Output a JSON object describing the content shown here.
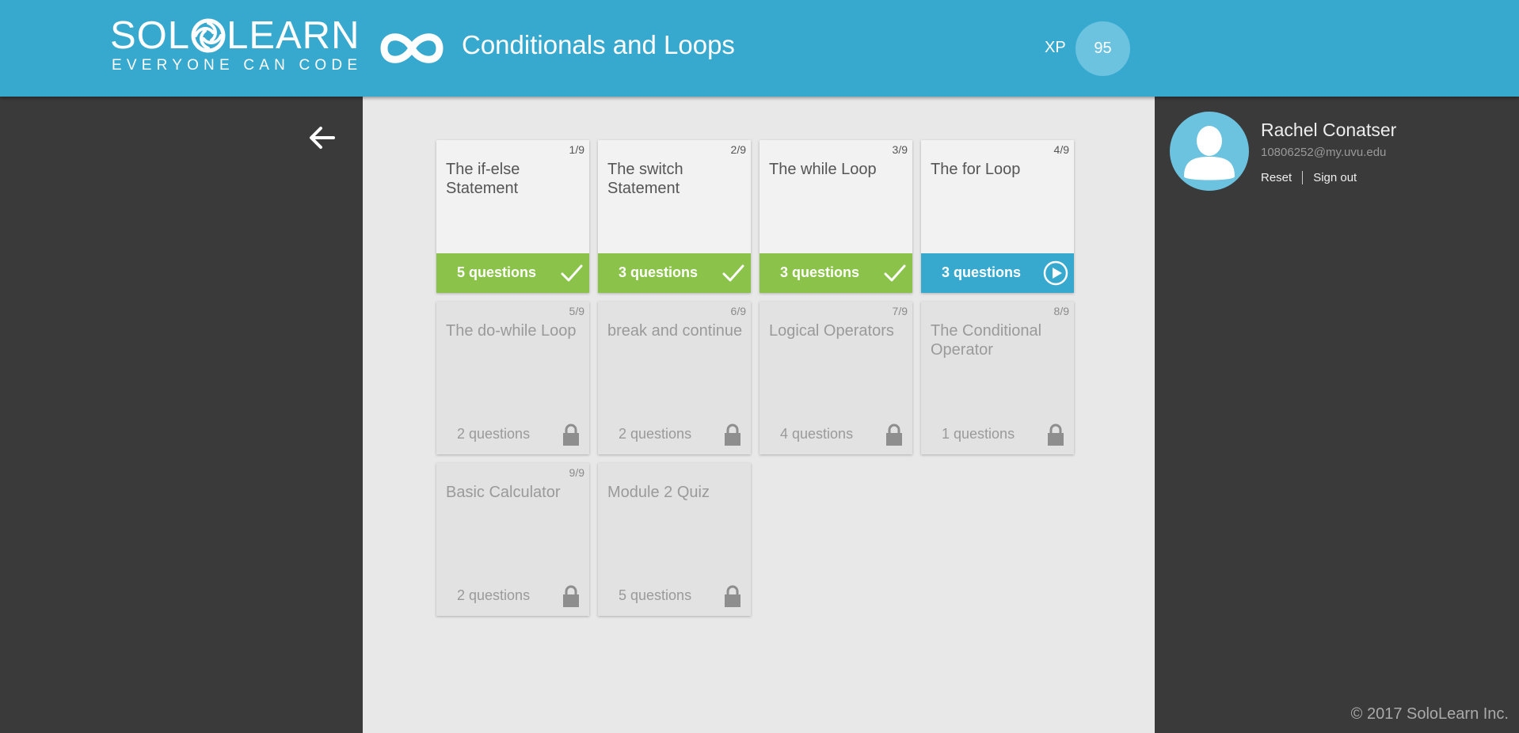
{
  "header": {
    "logo_left": "SOL",
    "logo_right": "LEARN",
    "logo_tagline": "EVERYONE CAN CODE",
    "course_icon": "infinity-icon",
    "course_title": "Conditionals and Loops",
    "xp_label": "XP",
    "xp_value": "95",
    "brand_color": "#37a9cf"
  },
  "nav": {
    "back_icon": "arrow-left-icon"
  },
  "lessons": [
    {
      "number": "1/9",
      "title": "The if-else Statement",
      "questions": "5 questions",
      "state": "done",
      "icon": "check-icon"
    },
    {
      "number": "2/9",
      "title": "The switch Statement",
      "questions": "3 questions",
      "state": "done",
      "icon": "check-icon"
    },
    {
      "number": "3/9",
      "title": "The while Loop",
      "questions": "3 questions",
      "state": "done",
      "icon": "check-icon"
    },
    {
      "number": "4/9",
      "title": "The for Loop",
      "questions": "3 questions",
      "state": "current",
      "icon": "play-icon"
    },
    {
      "number": "5/9",
      "title": "The do-while Loop",
      "questions": "2 questions",
      "state": "locked",
      "icon": "lock-icon"
    },
    {
      "number": "6/9",
      "title": "break and continue",
      "questions": "2 questions",
      "state": "locked",
      "icon": "lock-icon"
    },
    {
      "number": "7/9",
      "title": "Logical Operators",
      "questions": "4 questions",
      "state": "locked",
      "icon": "lock-icon"
    },
    {
      "number": "8/9",
      "title": "The Conditional Operator",
      "questions": "1 questions",
      "state": "locked",
      "icon": "lock-icon"
    },
    {
      "number": "9/9",
      "title": "Basic Calculator",
      "questions": "2 questions",
      "state": "locked",
      "icon": "lock-icon"
    },
    {
      "number": "",
      "title": "Module 2 Quiz",
      "questions": "5 questions",
      "state": "locked",
      "icon": "lock-icon"
    }
  ],
  "colors": {
    "done": "#8bc34a",
    "current": "#37a9cf",
    "locked": "#e2e2e2"
  },
  "profile": {
    "name": "Rachel Conatser",
    "email": "10806252@my.uvu.edu",
    "reset_label": "Reset",
    "signout_label": "Sign out",
    "avatar_icon": "user-avatar-icon"
  },
  "footer": {
    "copyright": "© 2017 SoloLearn Inc."
  }
}
